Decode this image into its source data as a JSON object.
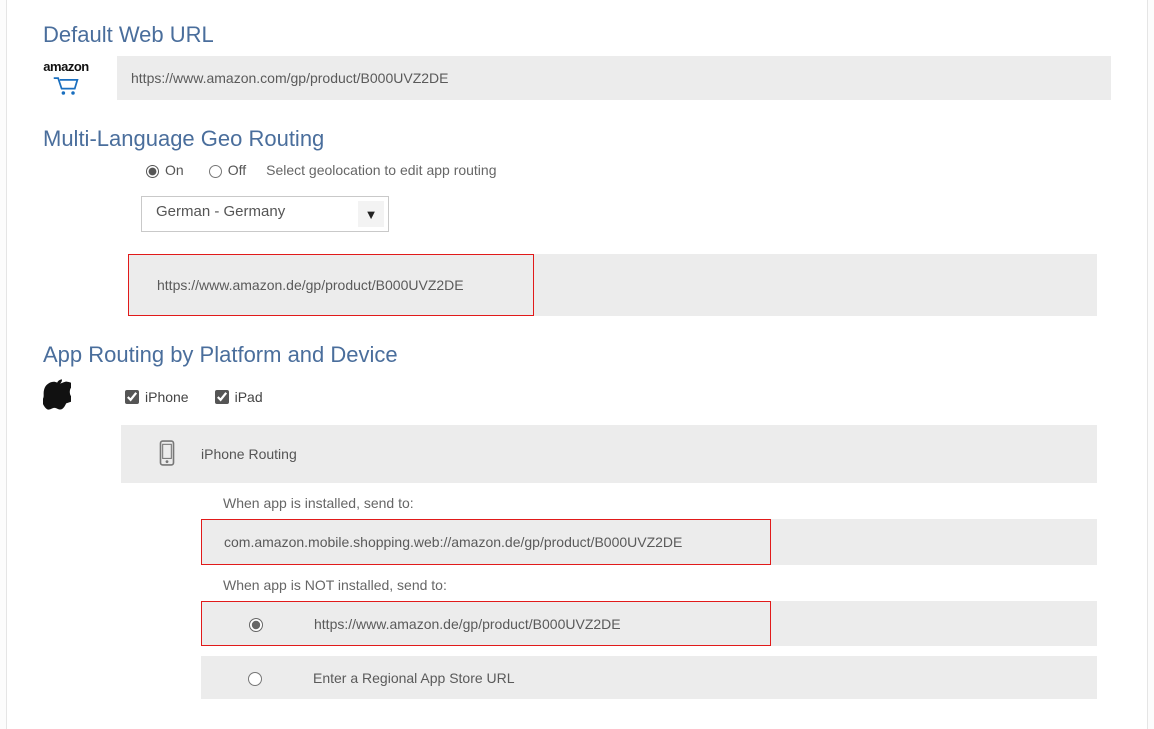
{
  "headings": {
    "default_url": "Default Web URL",
    "geo_routing": "Multi-Language Geo Routing",
    "app_routing": "App Routing by Platform and Device"
  },
  "brand_logo_text": "amazon",
  "default_url": "https://www.amazon.com/gp/product/B000UVZ2DE",
  "geo": {
    "on_label": "On",
    "off_label": "Off",
    "selected": "on",
    "hint": "Select geolocation to edit app routing",
    "locale_selected": "German - Germany",
    "locale_url": "https://www.amazon.de/gp/product/B000UVZ2DE"
  },
  "platform": {
    "iphone_label": "iPhone",
    "ipad_label": "iPad",
    "iphone_checked": true,
    "ipad_checked": true
  },
  "iphone_routing": {
    "title": "iPhone Routing",
    "installed_label": "When app is installed, send to:",
    "scheme_url": "com.amazon.mobile.shopping.web://amazon.de/gp/product/B000UVZ2DE",
    "not_installed_label": "When app is NOT installed, send to:",
    "fallback_selected": "web",
    "fallback_url": "https://www.amazon.de/gp/product/B000UVZ2DE",
    "app_store_label": "Enter a Regional App Store URL"
  }
}
